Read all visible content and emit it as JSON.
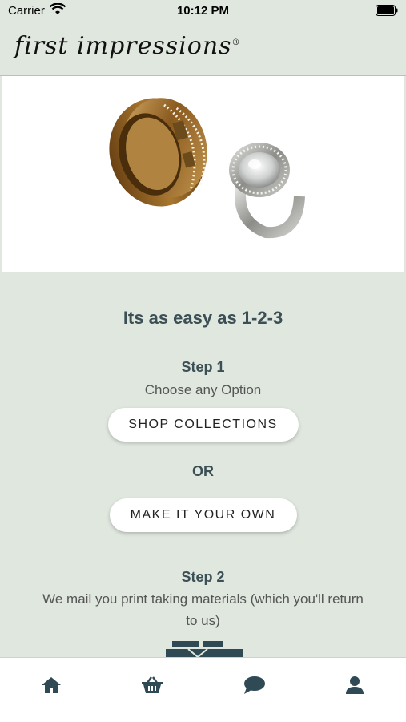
{
  "status_bar": {
    "carrier": "Carrier",
    "time": "10:12 PM"
  },
  "header": {
    "logo_text": "first impressions",
    "logo_mark": "®"
  },
  "hero": {
    "image": "gold-and-silver-rings"
  },
  "main": {
    "headline": "Its as easy as 1-2-3",
    "step1": {
      "title": "Step 1",
      "description": "Choose any Option",
      "shop_button": "SHOP COLLECTIONS",
      "or_label": "OR",
      "custom_button": "MAKE IT YOUR OWN"
    },
    "step2": {
      "title": "Step 2",
      "description": "We mail you print taking materials (which you'll return to us)"
    }
  },
  "tab_bar": {
    "items": [
      {
        "icon": "home-icon",
        "active": true
      },
      {
        "icon": "basket-icon",
        "active": false
      },
      {
        "icon": "chat-icon",
        "active": false
      },
      {
        "icon": "profile-icon",
        "active": false
      }
    ]
  },
  "colors": {
    "background": "#dfe7df",
    "accent": "#2f4a55",
    "heading": "#3b4f55"
  }
}
